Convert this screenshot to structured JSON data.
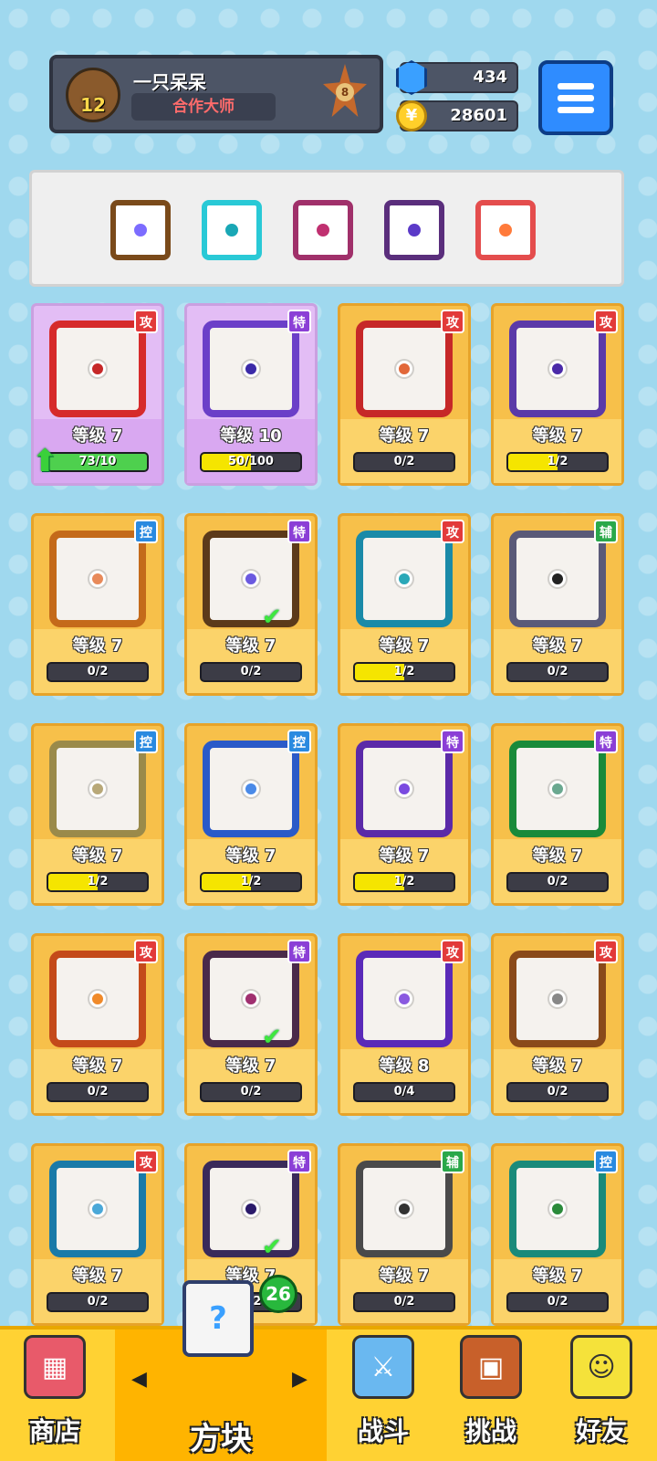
{
  "header": {
    "player_level": "12",
    "player_name": "一只呆呆",
    "player_title": "合作大师",
    "rank_number": "8"
  },
  "currency": {
    "gems": "434",
    "coins": "28601"
  },
  "deck": [
    {
      "icon": "infinity-dice-icon",
      "color": "#7a4a1a",
      "dot": "#7c6cff"
    },
    {
      "icon": "healing-dice-icon",
      "color": "#29c9d6",
      "dot": "#19a7b5"
    },
    {
      "icon": "crossbow-dice-icon",
      "color": "#a0306a",
      "dot": "#c03070"
    },
    {
      "icon": "spirit-dice-icon",
      "color": "#5a2e7c",
      "dot": "#5b3ac8"
    },
    {
      "icon": "rainbow-dice-icon",
      "color": "#e44d4d",
      "dot": "#ff7a3a"
    }
  ],
  "level_prefix": "等级",
  "cards": [
    {
      "tag": "攻",
      "tag_color": "#e23a3a",
      "level": "等级 7",
      "progress": "73/10",
      "ratio": 1,
      "bar_color": "#4ed04e",
      "frame": "#d62b2b",
      "dot": "#c62828",
      "current": true,
      "upgrade": true
    },
    {
      "tag": "特",
      "tag_color": "#8b3fd6",
      "level": "等级 10",
      "progress": "50/100",
      "ratio": 0.5,
      "bar_color": "#f5e500",
      "frame": "#6b3fc8",
      "dot": "#3b2aa8",
      "current": true
    },
    {
      "tag": "攻",
      "tag_color": "#e23a3a",
      "level": "等级 7",
      "progress": "0/2",
      "ratio": 0,
      "frame": "#c62828",
      "dot": "#e2683a"
    },
    {
      "tag": "攻",
      "tag_color": "#e23a3a",
      "level": "等级 7",
      "progress": "1/2",
      "ratio": 0.5,
      "bar_color": "#f5e500",
      "frame": "#5b3aa8",
      "dot": "#4a2aa8"
    },
    {
      "tag": "控",
      "tag_color": "#2a8ae0",
      "level": "等级 7",
      "progress": "0/2",
      "ratio": 0,
      "frame": "#c46a1a",
      "dot": "#e88a5a"
    },
    {
      "tag": "特",
      "tag_color": "#8b3fd6",
      "level": "等级 7",
      "progress": "0/2",
      "ratio": 0,
      "frame": "#5c3a1a",
      "dot": "#6b5ae0",
      "check": true
    },
    {
      "tag": "攻",
      "tag_color": "#e23a3a",
      "level": "等级 7",
      "progress": "1/2",
      "ratio": 0.5,
      "bar_color": "#f5e500",
      "frame": "#1a8aa8",
      "dot": "#2aa8b8"
    },
    {
      "tag": "辅",
      "tag_color": "#2aa84a",
      "level": "等级 7",
      "progress": "0/2",
      "ratio": 0,
      "frame": "#5a5a78",
      "dot": "#222"
    },
    {
      "tag": "控",
      "tag_color": "#2a8ae0",
      "level": "等级 7",
      "progress": "1/2",
      "ratio": 0.5,
      "bar_color": "#f5e500",
      "frame": "#9a8a4a",
      "dot": "#b8a878"
    },
    {
      "tag": "控",
      "tag_color": "#2a8ae0",
      "level": "等级 7",
      "progress": "1/2",
      "ratio": 0.5,
      "bar_color": "#f5e500",
      "frame": "#2a5ac8",
      "dot": "#4a8ae8"
    },
    {
      "tag": "特",
      "tag_color": "#8b3fd6",
      "level": "等级 7",
      "progress": "1/2",
      "ratio": 0.5,
      "bar_color": "#f5e500",
      "frame": "#5b2aa8",
      "dot": "#7a4ae0"
    },
    {
      "tag": "特",
      "tag_color": "#8b3fd6",
      "level": "等级 7",
      "progress": "0/2",
      "ratio": 0,
      "frame": "#1a8a3a",
      "dot": "#6aa890"
    },
    {
      "tag": "攻",
      "tag_color": "#e23a3a",
      "level": "等级 7",
      "progress": "0/2",
      "ratio": 0,
      "frame": "#c44a1a",
      "dot": "#f08a2a"
    },
    {
      "tag": "特",
      "tag_color": "#8b3fd6",
      "level": "等级 7",
      "progress": "0/2",
      "ratio": 0,
      "frame": "#4a2a4a",
      "dot": "#a03070",
      "check": true
    },
    {
      "tag": "攻",
      "tag_color": "#e23a3a",
      "level": "等级 8",
      "progress": "0/4",
      "ratio": 0,
      "frame": "#5a2ab8",
      "dot": "#8a5ae0"
    },
    {
      "tag": "攻",
      "tag_color": "#e23a3a",
      "level": "等级 7",
      "progress": "0/2",
      "ratio": 0,
      "frame": "#8a4a1a",
      "dot": "#888"
    },
    {
      "tag": "攻",
      "tag_color": "#e23a3a",
      "level": "等级 7",
      "progress": "0/2",
      "ratio": 0,
      "frame": "#1a7aa8",
      "dot": "#4aa8d8"
    },
    {
      "tag": "特",
      "tag_color": "#8b3fd6",
      "level": "等级 7",
      "progress": "0/2",
      "ratio": 0,
      "frame": "#3a2a5a",
      "dot": "#2a1a6a",
      "check": true
    },
    {
      "tag": "辅",
      "tag_color": "#2aa84a",
      "level": "等级 7",
      "progress": "0/2",
      "ratio": 0,
      "frame": "#4a4a4a",
      "dot": "#333"
    },
    {
      "tag": "控",
      "tag_color": "#2a8ae0",
      "level": "等级 7",
      "progress": "0/2",
      "ratio": 0,
      "frame": "#1a8a7a",
      "dot": "#2a8a3a"
    }
  ],
  "nav": {
    "shop": "商店",
    "blocks": "方块",
    "battle": "战斗",
    "challenge": "挑战",
    "friends": "好友",
    "blocks_badge": "26"
  }
}
